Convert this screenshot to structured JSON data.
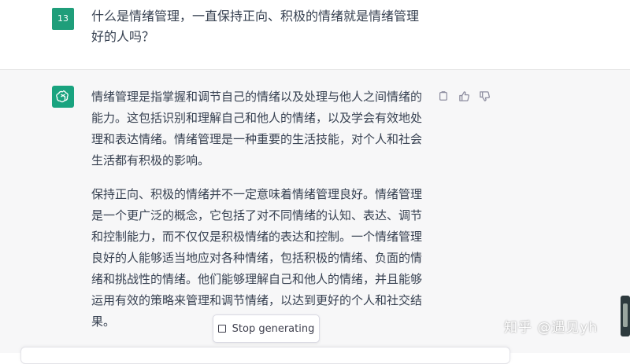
{
  "user_turn": {
    "avatar_label": "13",
    "message": "什么是情绪管理，一直保持正向、积极的情绪就是情绪管理好的人吗？"
  },
  "assistant_turn": {
    "paragraphs": [
      "情绪管理是指掌握和调节自己的情绪以及处理与他人之间情绪的能力。这包括识别和理解自己和他人的情绪，以及学会有效地处理和表达情绪。情绪管理是一种重要的生活技能，对个人和社会生活都有积极的影响。",
      "保持正向、积极的情绪并不一定意味着情绪管理良好。情绪管理是一个更广泛的概念，它包括了对不同情绪的认知、表达、调节和控制能力，而不仅仅是积极情绪的表达和控制。一个情绪管理良好的人能够适当地应对各种情绪，包括积极的情绪、负面的情绪和挑战性的情绪。他们能够理解自己和他人的情绪，并且能够运用有效的策略来管理和调节情绪，以达到更好的个人和社交结果。"
    ],
    "actions": [
      "copy-icon",
      "thumbs-up-icon",
      "thumbs-down-icon"
    ]
  },
  "controls": {
    "stop_label": "Stop generating"
  },
  "watermark": "知乎 @遇见yh",
  "colors": {
    "assistant_bg": "#f7f7f8",
    "avatar_green": "#19a37f",
    "user_avatar": "#1f9e7a"
  }
}
